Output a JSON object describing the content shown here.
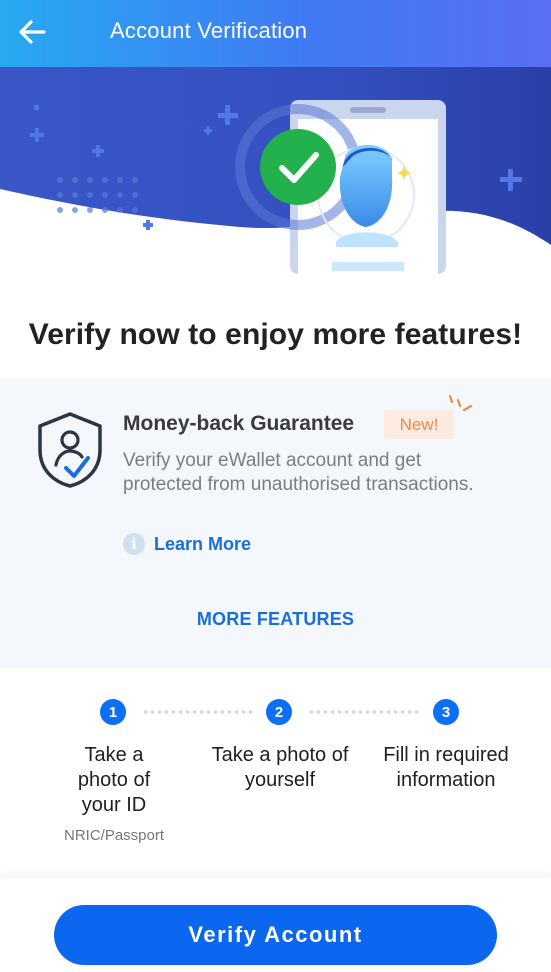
{
  "header": {
    "title": "Account Verification",
    "back_icon": "arrow-left-icon"
  },
  "hero": {
    "illustration": "phone-face-verified-illustration"
  },
  "headline": "Verify now to enjoy more features!",
  "feature": {
    "title": "Money-back Guarantee",
    "badge": "New!",
    "description": "Verify your eWallet account and get protected from unauthorised transactions.",
    "learn_more": "Learn More",
    "info_glyph": "i",
    "icon": "shield-user-check-icon"
  },
  "more_features": "MORE FEATURES",
  "steps": [
    {
      "number": "1",
      "label": "Take a photo of your ID",
      "sub": "NRIC/Passport"
    },
    {
      "number": "2",
      "label": "Take a photo of yourself",
      "sub": ""
    },
    {
      "number": "3",
      "label": "Fill in required information",
      "sub": ""
    }
  ],
  "cta": {
    "label": "Verify Account"
  },
  "colors": {
    "header_start": "#28a9f0",
    "header_end": "#5a6ff3",
    "primary": "#0b67f0",
    "link": "#1a6ed8",
    "badge_bg": "#fdebe1",
    "badge_text": "#f08a4b",
    "success": "#22b14c"
  }
}
